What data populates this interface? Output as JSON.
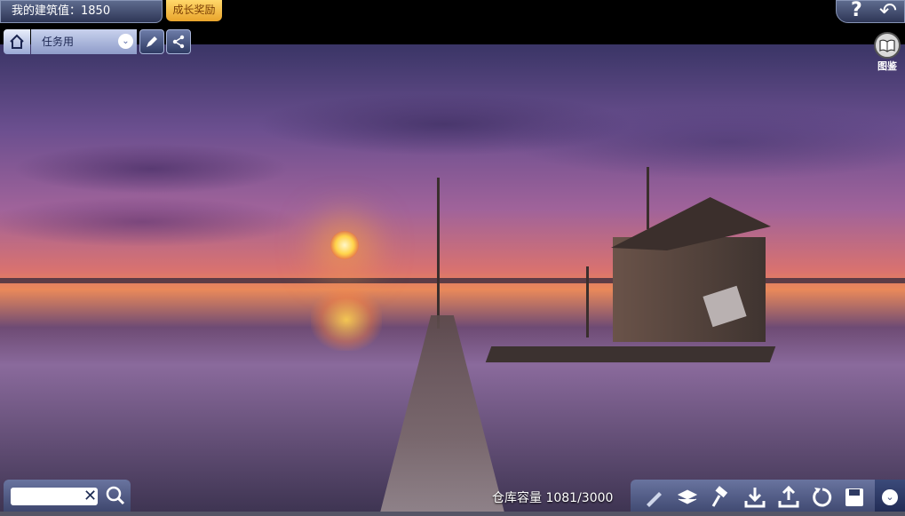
{
  "header": {
    "score_label": "我的建筑值：1850",
    "reward_button": "成长奖励",
    "help_icon": "?",
    "back_icon": "↶"
  },
  "toolbar": {
    "mode_select": "任务用"
  },
  "catalog": {
    "label": "图鉴"
  },
  "search": {
    "value": "",
    "placeholder": ""
  },
  "footer": {
    "capacity": "仓库容量 1081/3000"
  },
  "icons": [
    "home-icon",
    "chevron-down-icon",
    "pencil-icon",
    "share-icon",
    "book-icon",
    "clear-icon",
    "search-icon",
    "brush-icon",
    "layers-icon",
    "hammer-icon",
    "download-icon",
    "upload-icon",
    "refresh-icon",
    "save-icon",
    "expand-icon"
  ]
}
